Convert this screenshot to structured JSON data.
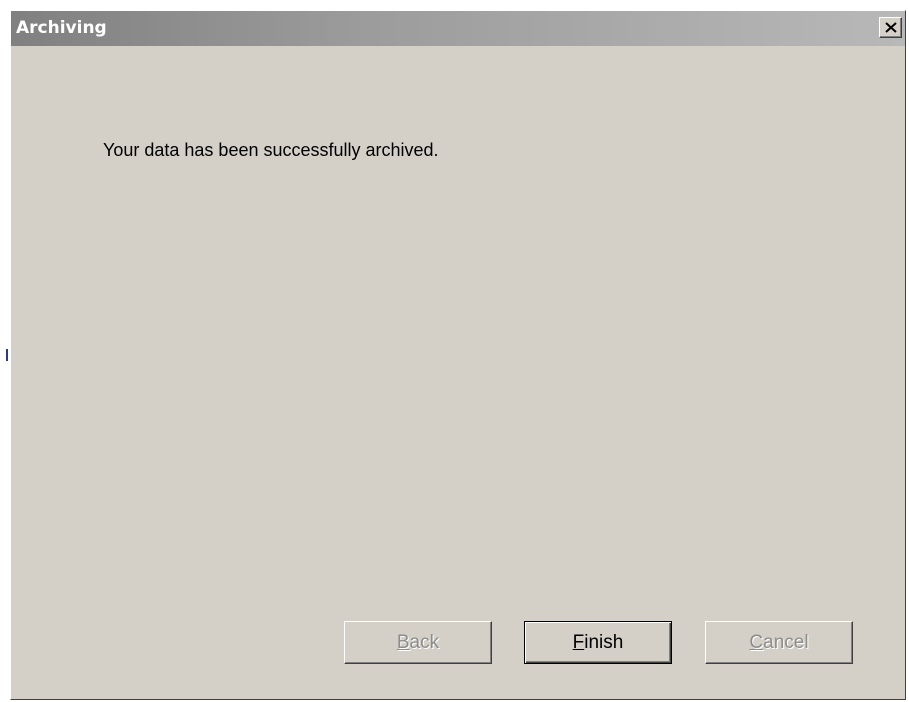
{
  "window": {
    "title": "Archiving",
    "close_icon": "close-icon",
    "close_glyph": "×"
  },
  "content": {
    "message": "Your data has been successfully archived."
  },
  "buttons": {
    "back": {
      "label_first": "B",
      "label_rest": "ack",
      "enabled": false
    },
    "finish": {
      "label_first": "F",
      "label_rest": "inish",
      "enabled": true,
      "default": true
    },
    "cancel": {
      "label_first": "C",
      "label_rest": "ancel",
      "enabled": false
    }
  },
  "colors": {
    "dialog_face": "#d4d0c8",
    "title_gradient_start": "#808080",
    "title_gradient_end": "#b8b8b8",
    "disabled_text": "#8c8c8c"
  }
}
